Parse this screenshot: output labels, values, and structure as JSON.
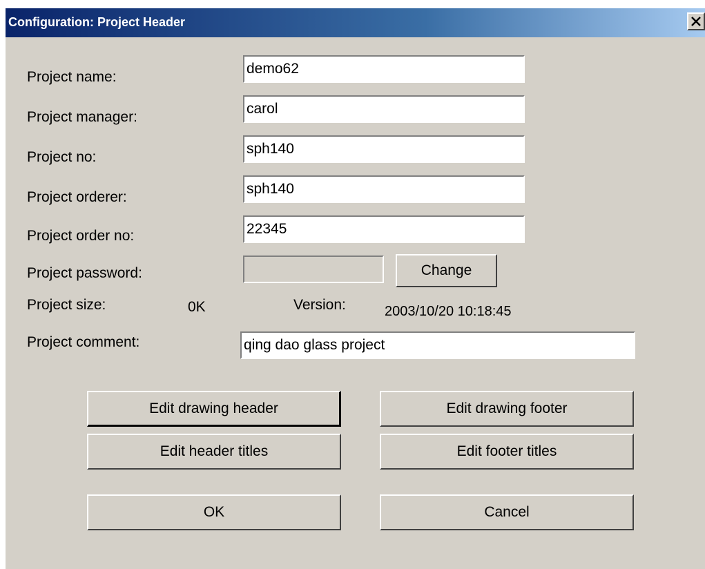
{
  "window": {
    "title": "Configuration: Project Header"
  },
  "fields": {
    "name": {
      "label": "Project name:",
      "value": "demo62"
    },
    "manager": {
      "label": "Project manager:",
      "value": "carol"
    },
    "number": {
      "label": "Project no:",
      "value": "sph140"
    },
    "orderer": {
      "label": "Project orderer:",
      "value": "sph140"
    },
    "order_no": {
      "label": "Project order no:",
      "value": "22345"
    },
    "password": {
      "label": "Project password:",
      "value": ""
    },
    "comment": {
      "label": "Project comment:",
      "value": "qing dao glass project"
    }
  },
  "info": {
    "size_label": "Project size:",
    "size_value": "0K",
    "version_label": "Version:",
    "version_value": "2003/10/20 10:18:45"
  },
  "buttons": {
    "change": "Change",
    "edit_drawing_header": "Edit drawing header",
    "edit_drawing_footer": "Edit drawing footer",
    "edit_header_titles": "Edit header titles",
    "edit_footer_titles": "Edit footer titles",
    "ok": "OK",
    "cancel": "Cancel"
  },
  "icons": {
    "close": "close-icon"
  },
  "colors": {
    "titlebar_start": "#0a246a",
    "titlebar_end": "#a6caf0",
    "dialog_face": "#d4d0c8"
  }
}
